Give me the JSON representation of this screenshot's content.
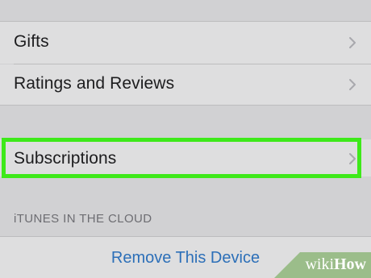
{
  "list": {
    "items": [
      {
        "label": "Gifts"
      },
      {
        "label": "Ratings and Reviews"
      },
      {
        "label": "Subscriptions"
      }
    ]
  },
  "cloud_section": {
    "header": "iTUNES IN THE CLOUD",
    "remove_device_label": "Remove This Device"
  },
  "watermark": {
    "wiki": "wiki",
    "how": "How"
  },
  "colors": {
    "highlight": "#3ee91a",
    "link": "#2c6fb8",
    "group_background": "#d1d1d3",
    "cell_background": "#dededf"
  }
}
